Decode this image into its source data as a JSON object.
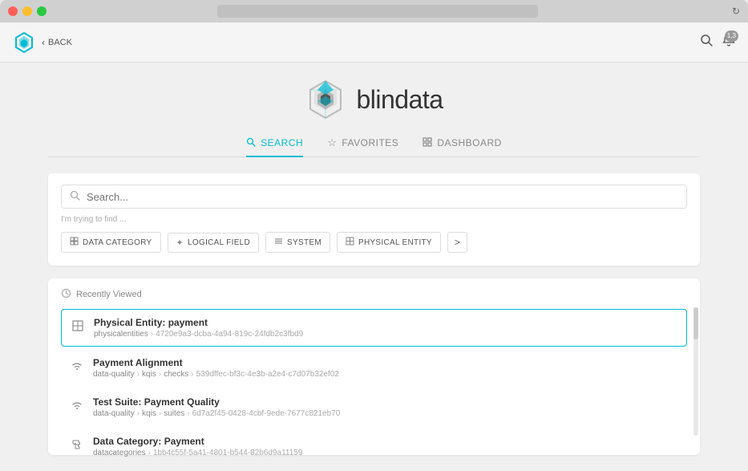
{
  "window": {
    "address_bar_text": "",
    "reload_icon": "↻"
  },
  "nav": {
    "back_label": "BACK",
    "logo_text_blin": "blin",
    "logo_text_data": "data",
    "search_icon": "🔍",
    "notification_icon": "🔔",
    "notification_count": "1,3"
  },
  "tabs": [
    {
      "id": "search",
      "label": "SEARCH",
      "icon": "🔍",
      "active": true
    },
    {
      "id": "favorites",
      "label": "FAVORITES",
      "icon": "☆",
      "active": false
    },
    {
      "id": "dashboard",
      "label": "DASHBOARD",
      "icon": "⊞",
      "active": false
    }
  ],
  "search": {
    "placeholder": "Search...",
    "trying_to_find_label": "I'm trying to find ..."
  },
  "categories": [
    {
      "id": "data-category",
      "label": "DATA CATEGORY",
      "icon": "⊞"
    },
    {
      "id": "logical-field",
      "label": "LOGICAL FIELD",
      "icon": "✦"
    },
    {
      "id": "system",
      "label": "SYSTEM",
      "icon": "≡"
    },
    {
      "id": "physical-entity",
      "label": "PHYSICAL ENTITY",
      "icon": "⊟"
    }
  ],
  "more_button_label": ">",
  "recently_viewed": {
    "header_label": "Recently Viewed",
    "items": [
      {
        "id": "item-1",
        "title": "Physical Entity: payment",
        "path_parts": [
          "physicalentities"
        ],
        "guid": "4720e9a3-dcba-4a94-819c-24fdb2c3fbd9",
        "icon_type": "physical-entity",
        "highlighted": true
      },
      {
        "id": "item-2",
        "title": "Payment Alignment",
        "path_parts": [
          "data-quality",
          "kqis",
          "checks"
        ],
        "guid": "539dffec-bf3c-4e3b-a2e4-c7d07b32ef02",
        "icon_type": "wifi",
        "highlighted": false
      },
      {
        "id": "item-3",
        "title": "Test Suite: Payment Quality",
        "path_parts": [
          "data-quality",
          "kqis",
          "suites"
        ],
        "guid": "6d7a2f45-0428-4cbf-9ede-7677c821eb70",
        "icon_type": "wifi",
        "highlighted": false
      },
      {
        "id": "item-4",
        "title": "Data Category: Payment",
        "path_parts": [
          "datacategories"
        ],
        "guid": "1bb4c55f-5a41-4801-b544-82b6d9a11159",
        "icon_type": "puzzle",
        "highlighted": false
      }
    ]
  }
}
